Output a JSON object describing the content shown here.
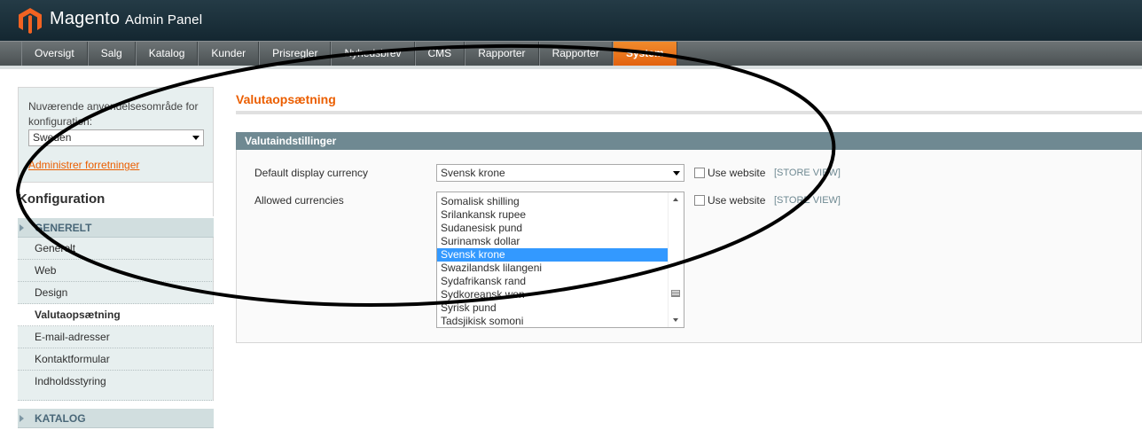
{
  "header": {
    "brand_main": "Magento",
    "brand_sub": "Admin Panel",
    "accent": "#eb5e00"
  },
  "nav": {
    "items": [
      "Oversigt",
      "Salg",
      "Katalog",
      "Kunder",
      "Prisregler",
      "Nyhedsbrev",
      "CMS",
      "Rapporter",
      "Rapporter",
      "System"
    ],
    "active": "System"
  },
  "sidebar": {
    "scope_label": "Nuværende anvendelsesområde for konfiguration:",
    "scope_value": "Sweden",
    "manage_link": "Administrer forretninger",
    "config_title": "Konfiguration",
    "groups": [
      {
        "label": "GENERELT"
      },
      {
        "label": "KATALOG"
      }
    ],
    "items": [
      "Generelt",
      "Web",
      "Design",
      "Valutaopsætning",
      "E-mail-adresser",
      "Kontaktformular",
      "Indholdsstyring"
    ],
    "active_item": "Valutaopsætning"
  },
  "main": {
    "page_title": "Valutaopsætning",
    "section_title": "Valutaindstillinger",
    "default_currency": {
      "label": "Default display currency",
      "value": "Svensk krone",
      "use_website": "Use website",
      "scope": "[STORE VIEW]"
    },
    "allowed_currencies": {
      "label": "Allowed currencies",
      "options": [
        "Somalisk shilling",
        "Srilankansk rupee",
        "Sudanesisk pund",
        "Surinamsk dollar",
        "Svensk krone",
        "Swazilandsk lilangeni",
        "Sydafrikansk rand",
        "Sydkoreansk won",
        "Syrisk pund",
        "Tadsjikisk somoni"
      ],
      "selected": "Svensk krone",
      "use_website": "Use website",
      "scope": "[STORE VIEW]"
    }
  }
}
